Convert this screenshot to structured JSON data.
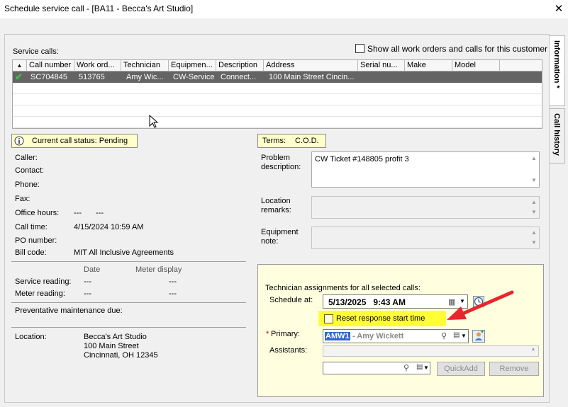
{
  "window": {
    "title": "Schedule service call - [BA11 - Becca's Art Studio]",
    "close": "✕"
  },
  "tabs": {
    "information": "Information *",
    "call_history": "Call history"
  },
  "service_calls": {
    "label": "Service calls:",
    "show_all_label": "Show all work orders and calls for this customer",
    "columns": [
      "Call number",
      "Work ord...",
      "Technician",
      "Equipmen...",
      "Description",
      "Address",
      "Serial nu...",
      "Make",
      "Model"
    ],
    "rows": [
      {
        "call_number": "SC704845",
        "work_order": "513765",
        "technician": "Amy Wic...",
        "equipment": "CW-Service",
        "description": "Connect...",
        "address": "100 Main Street Cincin...",
        "serial": "",
        "make": "",
        "model": ""
      }
    ]
  },
  "status": {
    "label": "Current call status: Pending"
  },
  "terms": {
    "label": "Terms:",
    "value": "C.O.D."
  },
  "contact": {
    "caller_label": "Caller:",
    "contact_label": "Contact:",
    "phone_label": "Phone:",
    "fax_label": "Fax:",
    "office_hours_label": "Office hours:",
    "office_hours_from": "---",
    "office_hours_to": "---",
    "call_time_label": "Call time:",
    "call_time": "4/15/2024 10:59 AM",
    "po_label": "PO number:",
    "bill_code_label": "Bill code:",
    "bill_code": "MIT All Inclusive Agreements"
  },
  "meter": {
    "date_header": "Date",
    "display_header": "Meter display",
    "service_label": "Service reading:",
    "service_date": "---",
    "service_display": "---",
    "meter_label": "Meter reading:",
    "meter_date": "---",
    "meter_display": "---"
  },
  "pm_label": "Preventative maintenance due:",
  "location": {
    "label": "Location:",
    "line1": "Becca's Art Studio",
    "line2": "100 Main Street",
    "line3": "Cincinnati, OH 12345"
  },
  "problem": {
    "label": "Problem description:",
    "value": "CW Ticket #148805 profit 3"
  },
  "location_remarks_label": "Location remarks:",
  "equipment_note_label": "Equipment note:",
  "assign": {
    "heading": "Technician assignments for all selected calls:",
    "schedule_label": "Schedule at:",
    "schedule_value": "5/13/2025   9:43 AM",
    "reset_label": "Reset response start time",
    "primary_star": "*",
    "primary_label": "Primary:",
    "primary_code": "AMW1",
    "primary_name": "- Amy Wickett",
    "assistants_label": "Assistants:",
    "quickadd": "QuickAdd",
    "remove": "Remove"
  },
  "colors": {
    "arrow": "#e8262c",
    "highlight": "#ffff33",
    "selection": "#646464",
    "panel": "#ffffe0"
  }
}
